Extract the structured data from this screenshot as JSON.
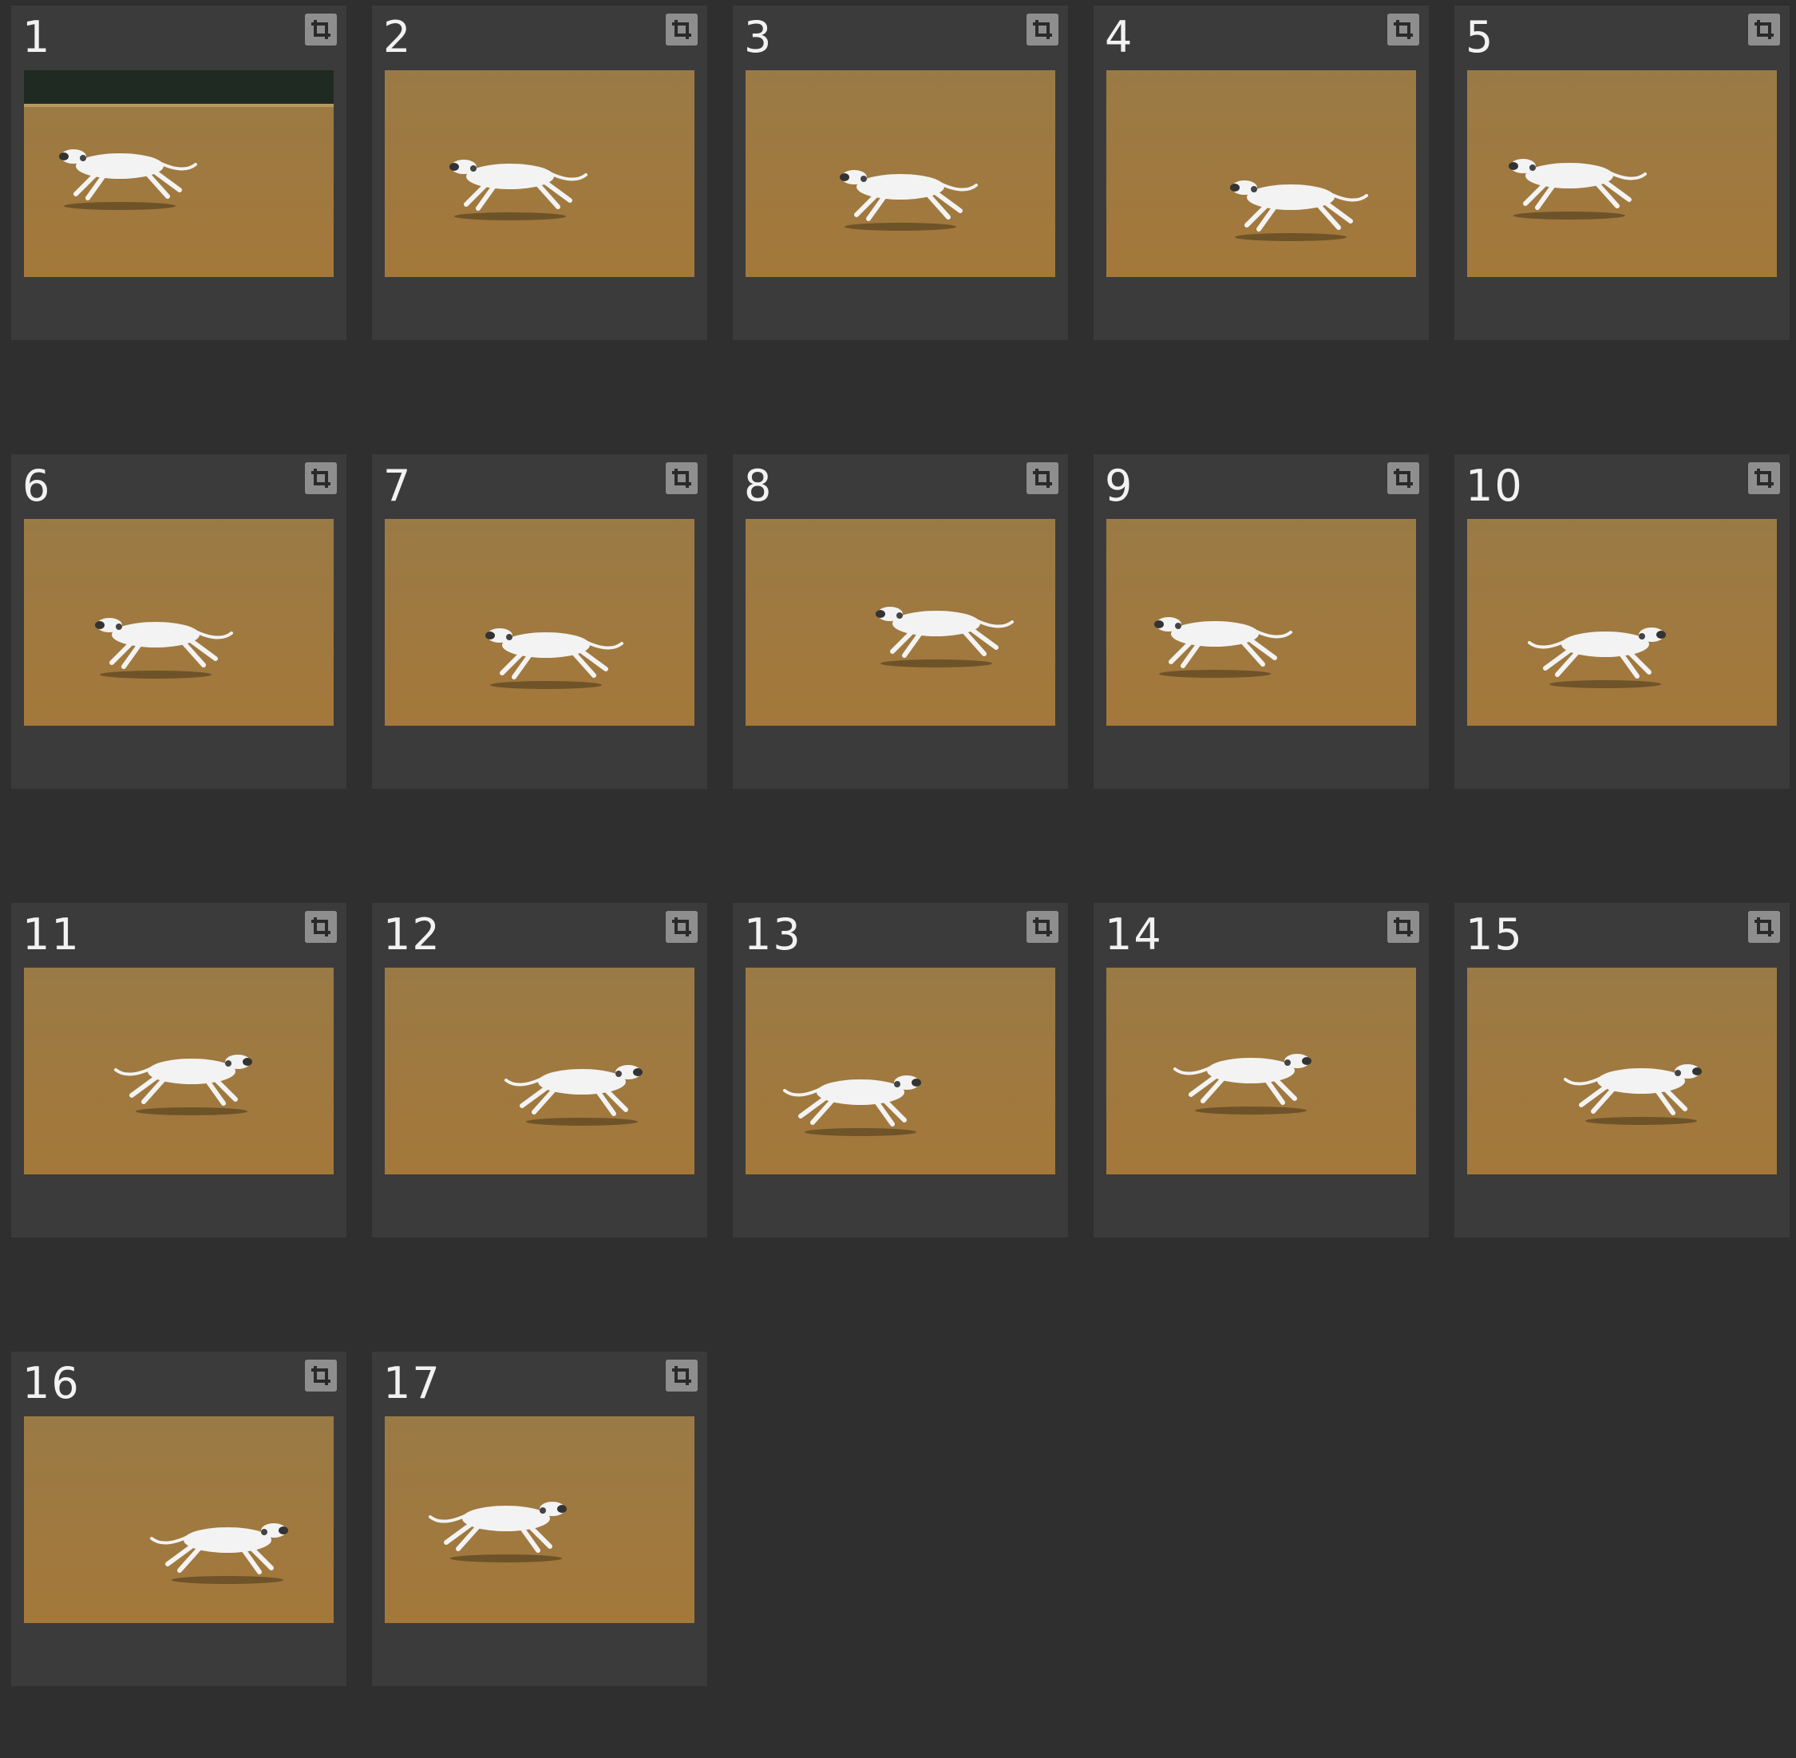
{
  "grid": {
    "items": [
      {
        "number": "1",
        "crop_icon": "crop-icon",
        "photo_alt": "photo-1"
      },
      {
        "number": "2",
        "crop_icon": "crop-icon",
        "photo_alt": "photo-2"
      },
      {
        "number": "3",
        "crop_icon": "crop-icon",
        "photo_alt": "photo-3"
      },
      {
        "number": "4",
        "crop_icon": "crop-icon",
        "photo_alt": "photo-4"
      },
      {
        "number": "5",
        "crop_icon": "crop-icon",
        "photo_alt": "photo-5"
      },
      {
        "number": "6",
        "crop_icon": "crop-icon",
        "photo_alt": "photo-6"
      },
      {
        "number": "7",
        "crop_icon": "crop-icon",
        "photo_alt": "photo-7"
      },
      {
        "number": "8",
        "crop_icon": "crop-icon",
        "photo_alt": "photo-8"
      },
      {
        "number": "9",
        "crop_icon": "crop-icon",
        "photo_alt": "photo-9"
      },
      {
        "number": "10",
        "crop_icon": "crop-icon",
        "photo_alt": "photo-10"
      },
      {
        "number": "11",
        "crop_icon": "crop-icon",
        "photo_alt": "photo-11"
      },
      {
        "number": "12",
        "crop_icon": "crop-icon",
        "photo_alt": "photo-12"
      },
      {
        "number": "13",
        "crop_icon": "crop-icon",
        "photo_alt": "photo-13"
      },
      {
        "number": "14",
        "crop_icon": "crop-icon",
        "photo_alt": "photo-14"
      },
      {
        "number": "15",
        "crop_icon": "crop-icon",
        "photo_alt": "photo-15"
      },
      {
        "number": "16",
        "crop_icon": "crop-icon",
        "photo_alt": "photo-16"
      },
      {
        "number": "17",
        "crop_icon": "crop-icon",
        "photo_alt": "photo-17"
      }
    ]
  },
  "colors": {
    "background": "#2f2f2f",
    "cell": "#3b3b3b",
    "number_text": "#f2f2f2",
    "field": "#a07a3c",
    "dog": "#f3f3f3"
  }
}
